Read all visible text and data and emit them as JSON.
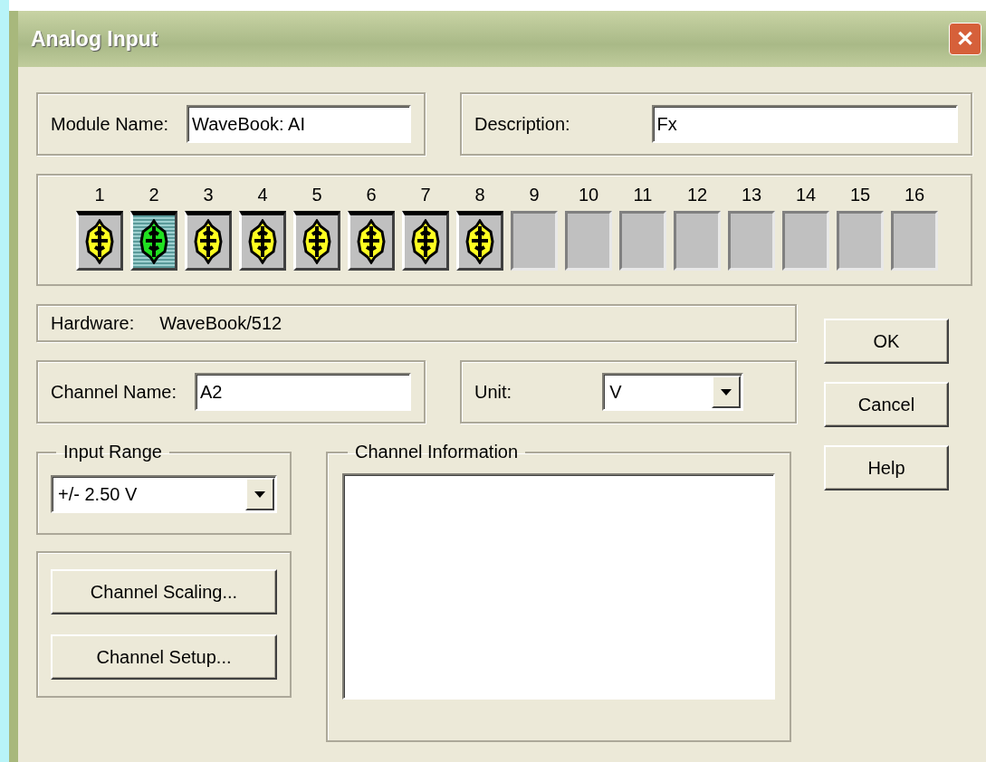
{
  "window": {
    "title": "Analog Input",
    "close": "✕"
  },
  "module_name": {
    "label": "Module Name:",
    "value": "WaveBook: AI"
  },
  "description": {
    "label": "Description:",
    "value": "Fx"
  },
  "channels": [
    {
      "label": "1",
      "kind": "module",
      "selected": false
    },
    {
      "label": "2",
      "kind": "module",
      "selected": true
    },
    {
      "label": "3",
      "kind": "module",
      "selected": false
    },
    {
      "label": "4",
      "kind": "module",
      "selected": false
    },
    {
      "label": "5",
      "kind": "module",
      "selected": false
    },
    {
      "label": "6",
      "kind": "module",
      "selected": false
    },
    {
      "label": "7",
      "kind": "module",
      "selected": false
    },
    {
      "label": "8",
      "kind": "module",
      "selected": false
    },
    {
      "label": "9",
      "kind": "empty",
      "selected": false
    },
    {
      "label": "10",
      "kind": "empty",
      "selected": false
    },
    {
      "label": "11",
      "kind": "empty",
      "selected": false
    },
    {
      "label": "12",
      "kind": "empty",
      "selected": false
    },
    {
      "label": "13",
      "kind": "empty",
      "selected": false
    },
    {
      "label": "14",
      "kind": "empty",
      "selected": false
    },
    {
      "label": "15",
      "kind": "empty",
      "selected": false
    },
    {
      "label": "16",
      "kind": "empty",
      "selected": false
    }
  ],
  "hardware": {
    "label": "Hardware:",
    "value": "WaveBook/512"
  },
  "channel_name": {
    "label": "Channel Name:",
    "value": "A2"
  },
  "unit": {
    "label": "Unit:",
    "value": "V"
  },
  "input_range": {
    "title": "Input Range",
    "value": "+/- 2.50 V"
  },
  "channel_information": {
    "title": "Channel Information"
  },
  "side_buttons": [
    "Channel Scaling...",
    "Channel Setup..."
  ],
  "buttons": [
    "OK",
    "Cancel",
    "Help"
  ]
}
